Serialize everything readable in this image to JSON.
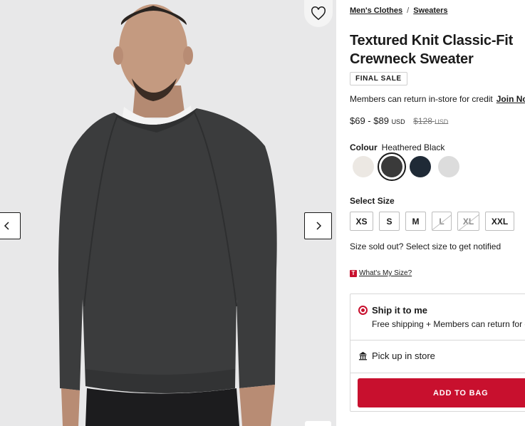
{
  "breadcrumb": {
    "item1": "Men's Clothes",
    "separator": "/",
    "item2": "Sweaters"
  },
  "product": {
    "title": "Textured Knit Classic-Fit Crewneck Sweater",
    "badge": "FINAL SALE",
    "members_text": "Members can return in-store for credit",
    "join_link": "Join No",
    "price_range": "$69 - $89",
    "price_currency": "USD",
    "old_price": "$128",
    "old_currency": "USD"
  },
  "colour": {
    "label": "Colour",
    "selected_name": "Heathered Black",
    "swatches": [
      {
        "name": "cream",
        "color": "#ece8e3"
      },
      {
        "name": "heathered-black",
        "color": "#3a3a3a"
      },
      {
        "name": "navy",
        "color": "#1f2a36"
      },
      {
        "name": "light-grey",
        "color": "#dcdcdc"
      }
    ]
  },
  "size": {
    "label": "Select Size",
    "options": [
      {
        "label": "XS",
        "available": true
      },
      {
        "label": "S",
        "available": true
      },
      {
        "label": "M",
        "available": true
      },
      {
        "label": "L",
        "available": false
      },
      {
        "label": "XL",
        "available": false
      },
      {
        "label": "XXL",
        "available": true
      }
    ],
    "sold_out_text": "Size sold out? Select size to get notified",
    "whats_my_size_icon": "T",
    "whats_my_size": "What's My Size?"
  },
  "shipping": {
    "ship_title": "Ship it to me",
    "ship_sub": "Free shipping + Members can return for c",
    "pickup": "Pick up in store"
  },
  "cta": {
    "add_to_bag": "ADD TO BAG"
  },
  "colors": {
    "accent": "#c8102e"
  }
}
